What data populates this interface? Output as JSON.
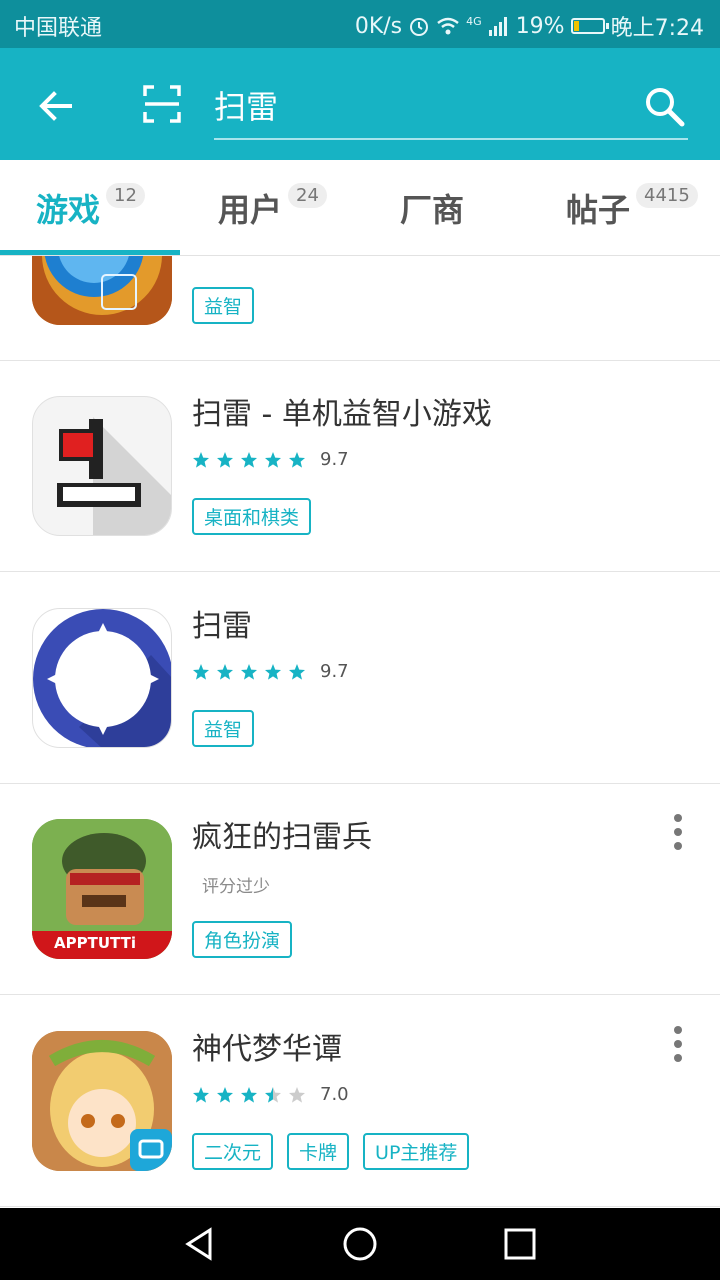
{
  "status": {
    "carrier": "中国联通",
    "speed": "0K/s",
    "network": "4G",
    "battery": "19%",
    "battery_level": 0.19,
    "time": "晚上7:24"
  },
  "toolbar": {
    "query": "扫雷"
  },
  "tabs": [
    {
      "label": "游戏",
      "count": "12",
      "active": true
    },
    {
      "label": "用户",
      "count": "24"
    },
    {
      "label": "厂商"
    },
    {
      "label": "帖子",
      "count": "4415"
    }
  ],
  "items": [
    {
      "title": "",
      "tags": [
        "益智"
      ]
    },
    {
      "title": "扫雷 - 单机益智小游戏",
      "score": "9.7",
      "stars": 5,
      "tags": [
        "桌面和棋类"
      ]
    },
    {
      "title": "扫雷",
      "score": "9.7",
      "stars": 5,
      "tags": [
        "益智"
      ]
    },
    {
      "title": "疯狂的扫雷兵",
      "rating_text": "评分过少",
      "tags": [
        "角色扮演"
      ],
      "icon_text": "APPTUTTi"
    },
    {
      "title": "神代梦华谭",
      "score": "7.0",
      "stars": 3.5,
      "tags": [
        "二次元",
        "卡牌",
        "UP主推荐"
      ]
    }
  ],
  "colors": {
    "accent": "#17b3c4",
    "statusbar": "#0e8f9c",
    "star_empty": "#cccccc"
  },
  "icons": [
    "back-arrow-icon",
    "scan-icon",
    "search-icon",
    "alarm-icon",
    "wifi-icon",
    "signal-icon",
    "battery-icon",
    "more-vert-icon",
    "nav-back-icon",
    "nav-home-icon",
    "nav-recents-icon"
  ]
}
